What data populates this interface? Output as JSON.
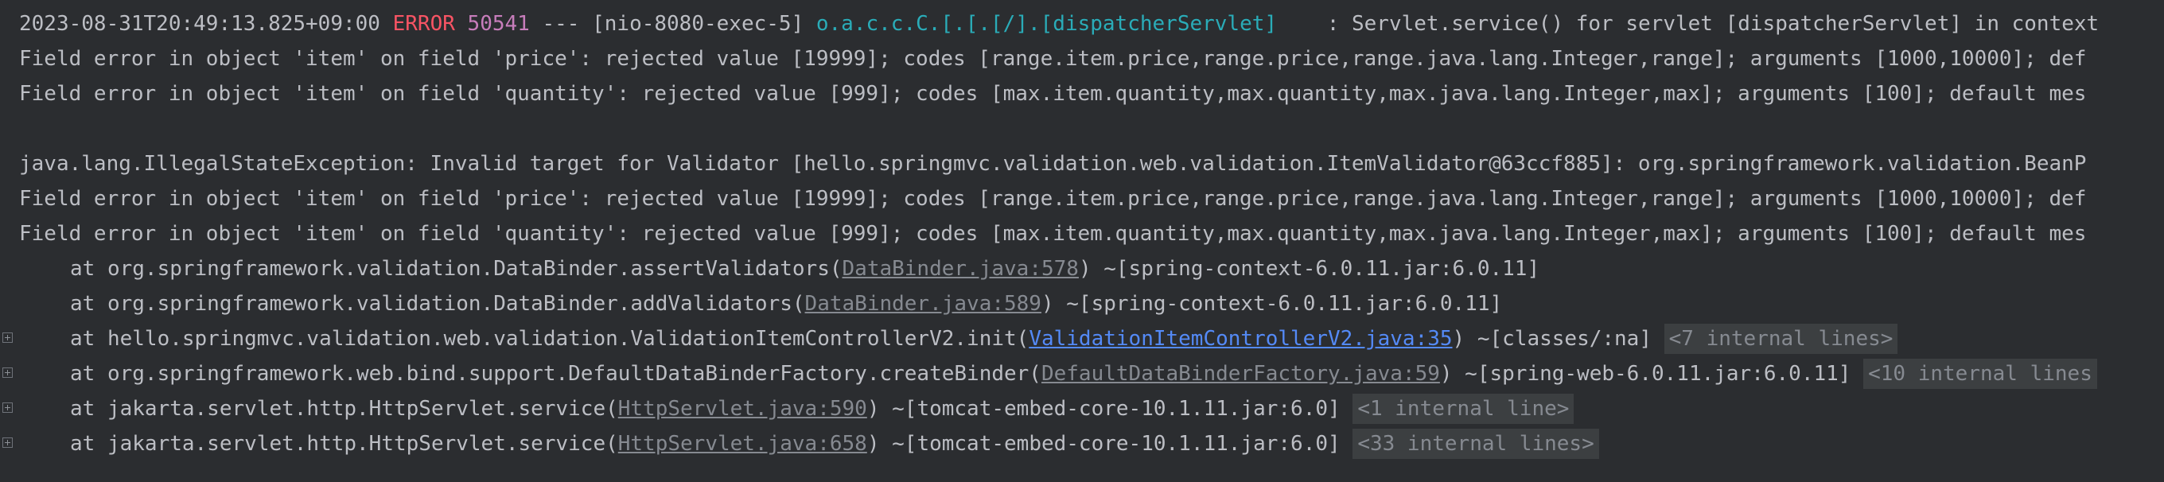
{
  "console": {
    "l1": {
      "timestamp": "2023-08-31T20:49:13.825+09:00",
      "level": "ERROR",
      "pid": "50541",
      "sep": "---",
      "thread": "[nio-8080-exec-5]",
      "logger": "o.a.c.c.C.[.[.[/].[dispatcherServlet]",
      "message": ": Servlet.service() for servlet [dispatcherServlet] in context"
    },
    "l2": "Field error in object 'item' on field 'price': rejected value [19999]; codes [range.item.price,range.price,range.java.lang.Integer,range]; arguments [1000,10000]; def",
    "l3": "Field error in object 'item' on field 'quantity': rejected value [999]; codes [max.item.quantity,max.quantity,max.java.lang.Integer,max]; arguments [100]; default mes",
    "l5": "java.lang.IllegalStateException: Invalid target for Validator [hello.springmvc.validation.web.validation.ItemValidator@63ccf885]: org.springframework.validation.BeanP",
    "l6": "Field error in object 'item' on field 'price': rejected value [19999]; codes [range.item.price,range.price,range.java.lang.Integer,range]; arguments [1000,10000]; def",
    "l7": "Field error in object 'item' on field 'quantity': rejected value [999]; codes [max.item.quantity,max.quantity,max.java.lang.Integer,max]; arguments [100]; default mes",
    "frames": [
      {
        "prefix": "at org.springframework.validation.DataBinder.assertValidators(",
        "link": "DataBinder.java:578",
        "suffix": ") ~[spring-context-6.0.11.jar:6.0.11]"
      },
      {
        "prefix": "at org.springframework.validation.DataBinder.addValidators(",
        "link": "DataBinder.java:589",
        "suffix": ") ~[spring-context-6.0.11.jar:6.0.11]"
      },
      {
        "prefix": "at hello.springmvc.validation.web.validation.ValidationItemControllerV2.init(",
        "link": "ValidationItemControllerV2.java:35",
        "suffix": ") ~[classes/:na] ",
        "badge": "<7 internal lines>"
      },
      {
        "prefix": "at org.springframework.web.bind.support.DefaultDataBinderFactory.createBinder(",
        "link": "DefaultDataBinderFactory.java:59",
        "suffix": ") ~[spring-web-6.0.11.jar:6.0.11] ",
        "badge": "<10 internal lines"
      },
      {
        "prefix": "at jakarta.servlet.http.HttpServlet.service(",
        "link": "HttpServlet.java:590",
        "suffix": ") ~[tomcat-embed-core-10.1.11.jar:6.0] ",
        "badge": "<1 internal line>"
      },
      {
        "prefix": "at jakarta.servlet.http.HttpServlet.service(",
        "link": "HttpServlet.java:658",
        "suffix": ") ~[tomcat-embed-core-10.1.11.jar:6.0] ",
        "badge": "<33 internal lines>"
      }
    ]
  },
  "colors": {
    "background": "#2b2d30",
    "text": "#bcbec4",
    "error": "#f75464",
    "pid": "#c77dbb",
    "logger": "#2aacb8",
    "link_gray": "#868a91",
    "link_blue": "#548af7"
  }
}
